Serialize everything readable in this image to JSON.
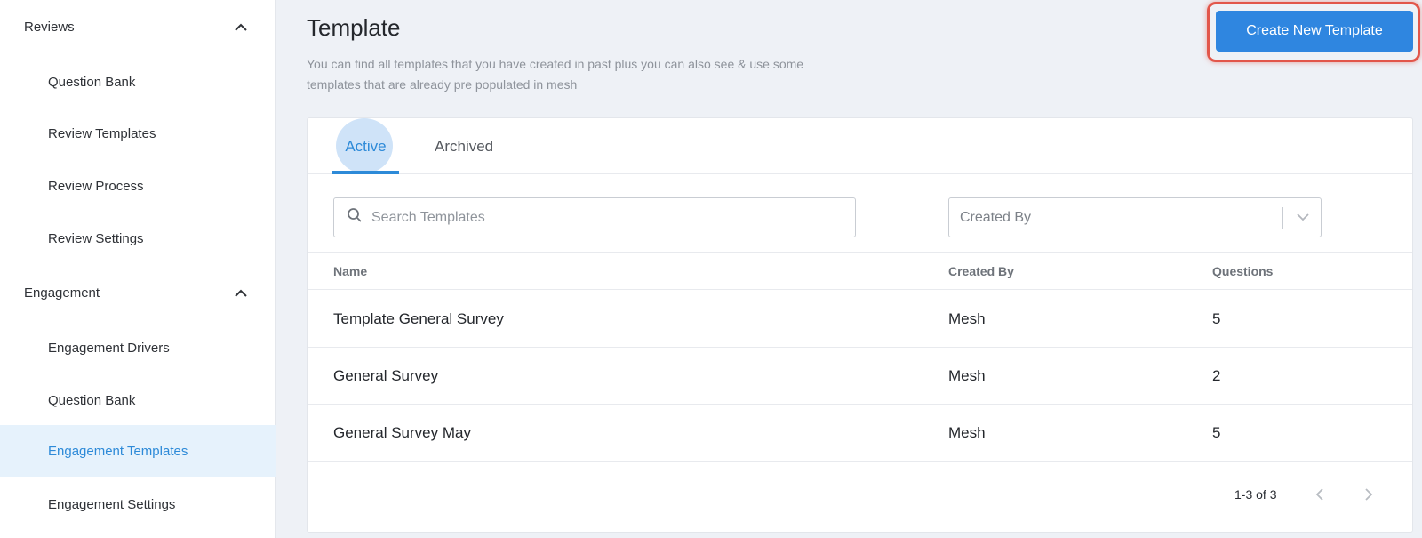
{
  "sidebar": {
    "groups": [
      {
        "label": "Reviews",
        "items": [
          "Question Bank",
          "Review Templates",
          "Review Process",
          "Review Settings"
        ]
      },
      {
        "label": "Engagement",
        "items": [
          "Engagement Drivers",
          "Question Bank",
          "Engagement Templates",
          "Engagement Settings"
        ]
      }
    ],
    "active_item": "Engagement Templates"
  },
  "header": {
    "title": "Template",
    "description": "You can find all templates that you have created in past plus you can also see & use some templates that are already pre populated in mesh",
    "create_button": "Create New Template"
  },
  "tabs": [
    {
      "label": "Active",
      "active": true
    },
    {
      "label": "Archived",
      "active": false
    }
  ],
  "filters": {
    "search_placeholder": "Search Templates",
    "created_by_placeholder": "Created By"
  },
  "table": {
    "columns": [
      "Name",
      "Created By",
      "Questions"
    ],
    "rows": [
      {
        "name": "Template General Survey",
        "created_by": "Mesh",
        "questions": "5"
      },
      {
        "name": "General Survey",
        "created_by": "Mesh",
        "questions": "2"
      },
      {
        "name": "General Survey May",
        "created_by": "Mesh",
        "questions": "5"
      }
    ]
  },
  "pagination": {
    "range_text": "1-3 of 3"
  },
  "colors": {
    "accent": "#2d8ad8",
    "button": "#2f86e0",
    "highlight_border": "#e2564a",
    "active_bg": "#e6f2fc"
  },
  "icons": [
    "chevron-up-icon",
    "search-icon",
    "chevron-down-icon",
    "chevron-left-icon",
    "chevron-right-icon"
  ]
}
